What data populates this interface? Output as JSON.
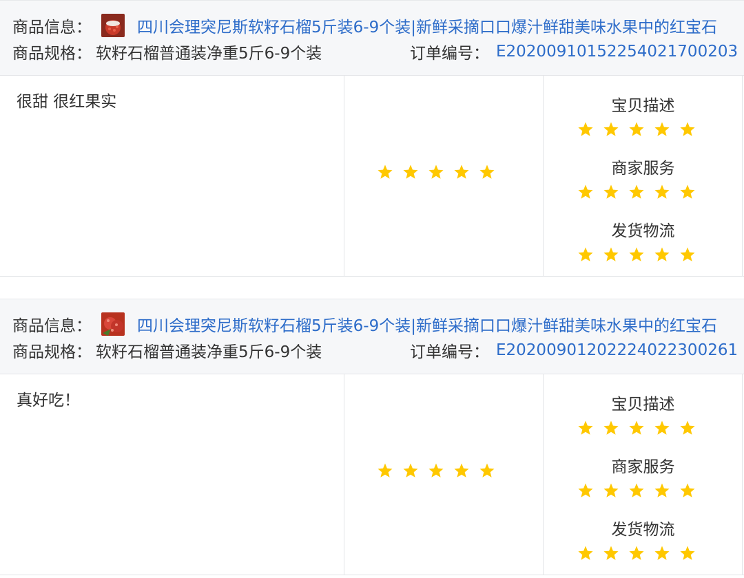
{
  "colors": {
    "link": "#2d6cc9",
    "star": "#ffc800",
    "header_bg": "#f6f7f9",
    "text": "#333333"
  },
  "reviews": [
    {
      "product_label": "商品信息：",
      "product_title": "四川会理突尼斯软籽石榴5斤装6-9个装|新鲜采摘口口爆汁鲜甜美味水果中的红宝石",
      "spec_label": "商品规格：",
      "spec_value": "软籽石榴普通装净重5斤6-9个装",
      "order_label": "订单编号：",
      "order_no": "E20200910152254021700203",
      "comment": "很甜 很红果实",
      "overall_rating": 5,
      "detail_ratings": [
        {
          "label": "宝贝描述",
          "rating": 5
        },
        {
          "label": "商家服务",
          "rating": 5
        },
        {
          "label": "发货物流",
          "rating": 5
        }
      ]
    },
    {
      "product_label": "商品信息：",
      "product_title": "四川会理突尼斯软籽石榴5斤装6-9个装|新鲜采摘口口爆汁鲜甜美味水果中的红宝石",
      "spec_label": "商品规格：",
      "spec_value": "软籽石榴普通装净重5斤6-9个装",
      "order_label": "订单编号：",
      "order_no": "E20200901202224022300261",
      "comment": "真好吃！",
      "overall_rating": 5,
      "detail_ratings": [
        {
          "label": "宝贝描述",
          "rating": 5
        },
        {
          "label": "商家服务",
          "rating": 5
        },
        {
          "label": "发货物流",
          "rating": 5
        }
      ]
    }
  ]
}
